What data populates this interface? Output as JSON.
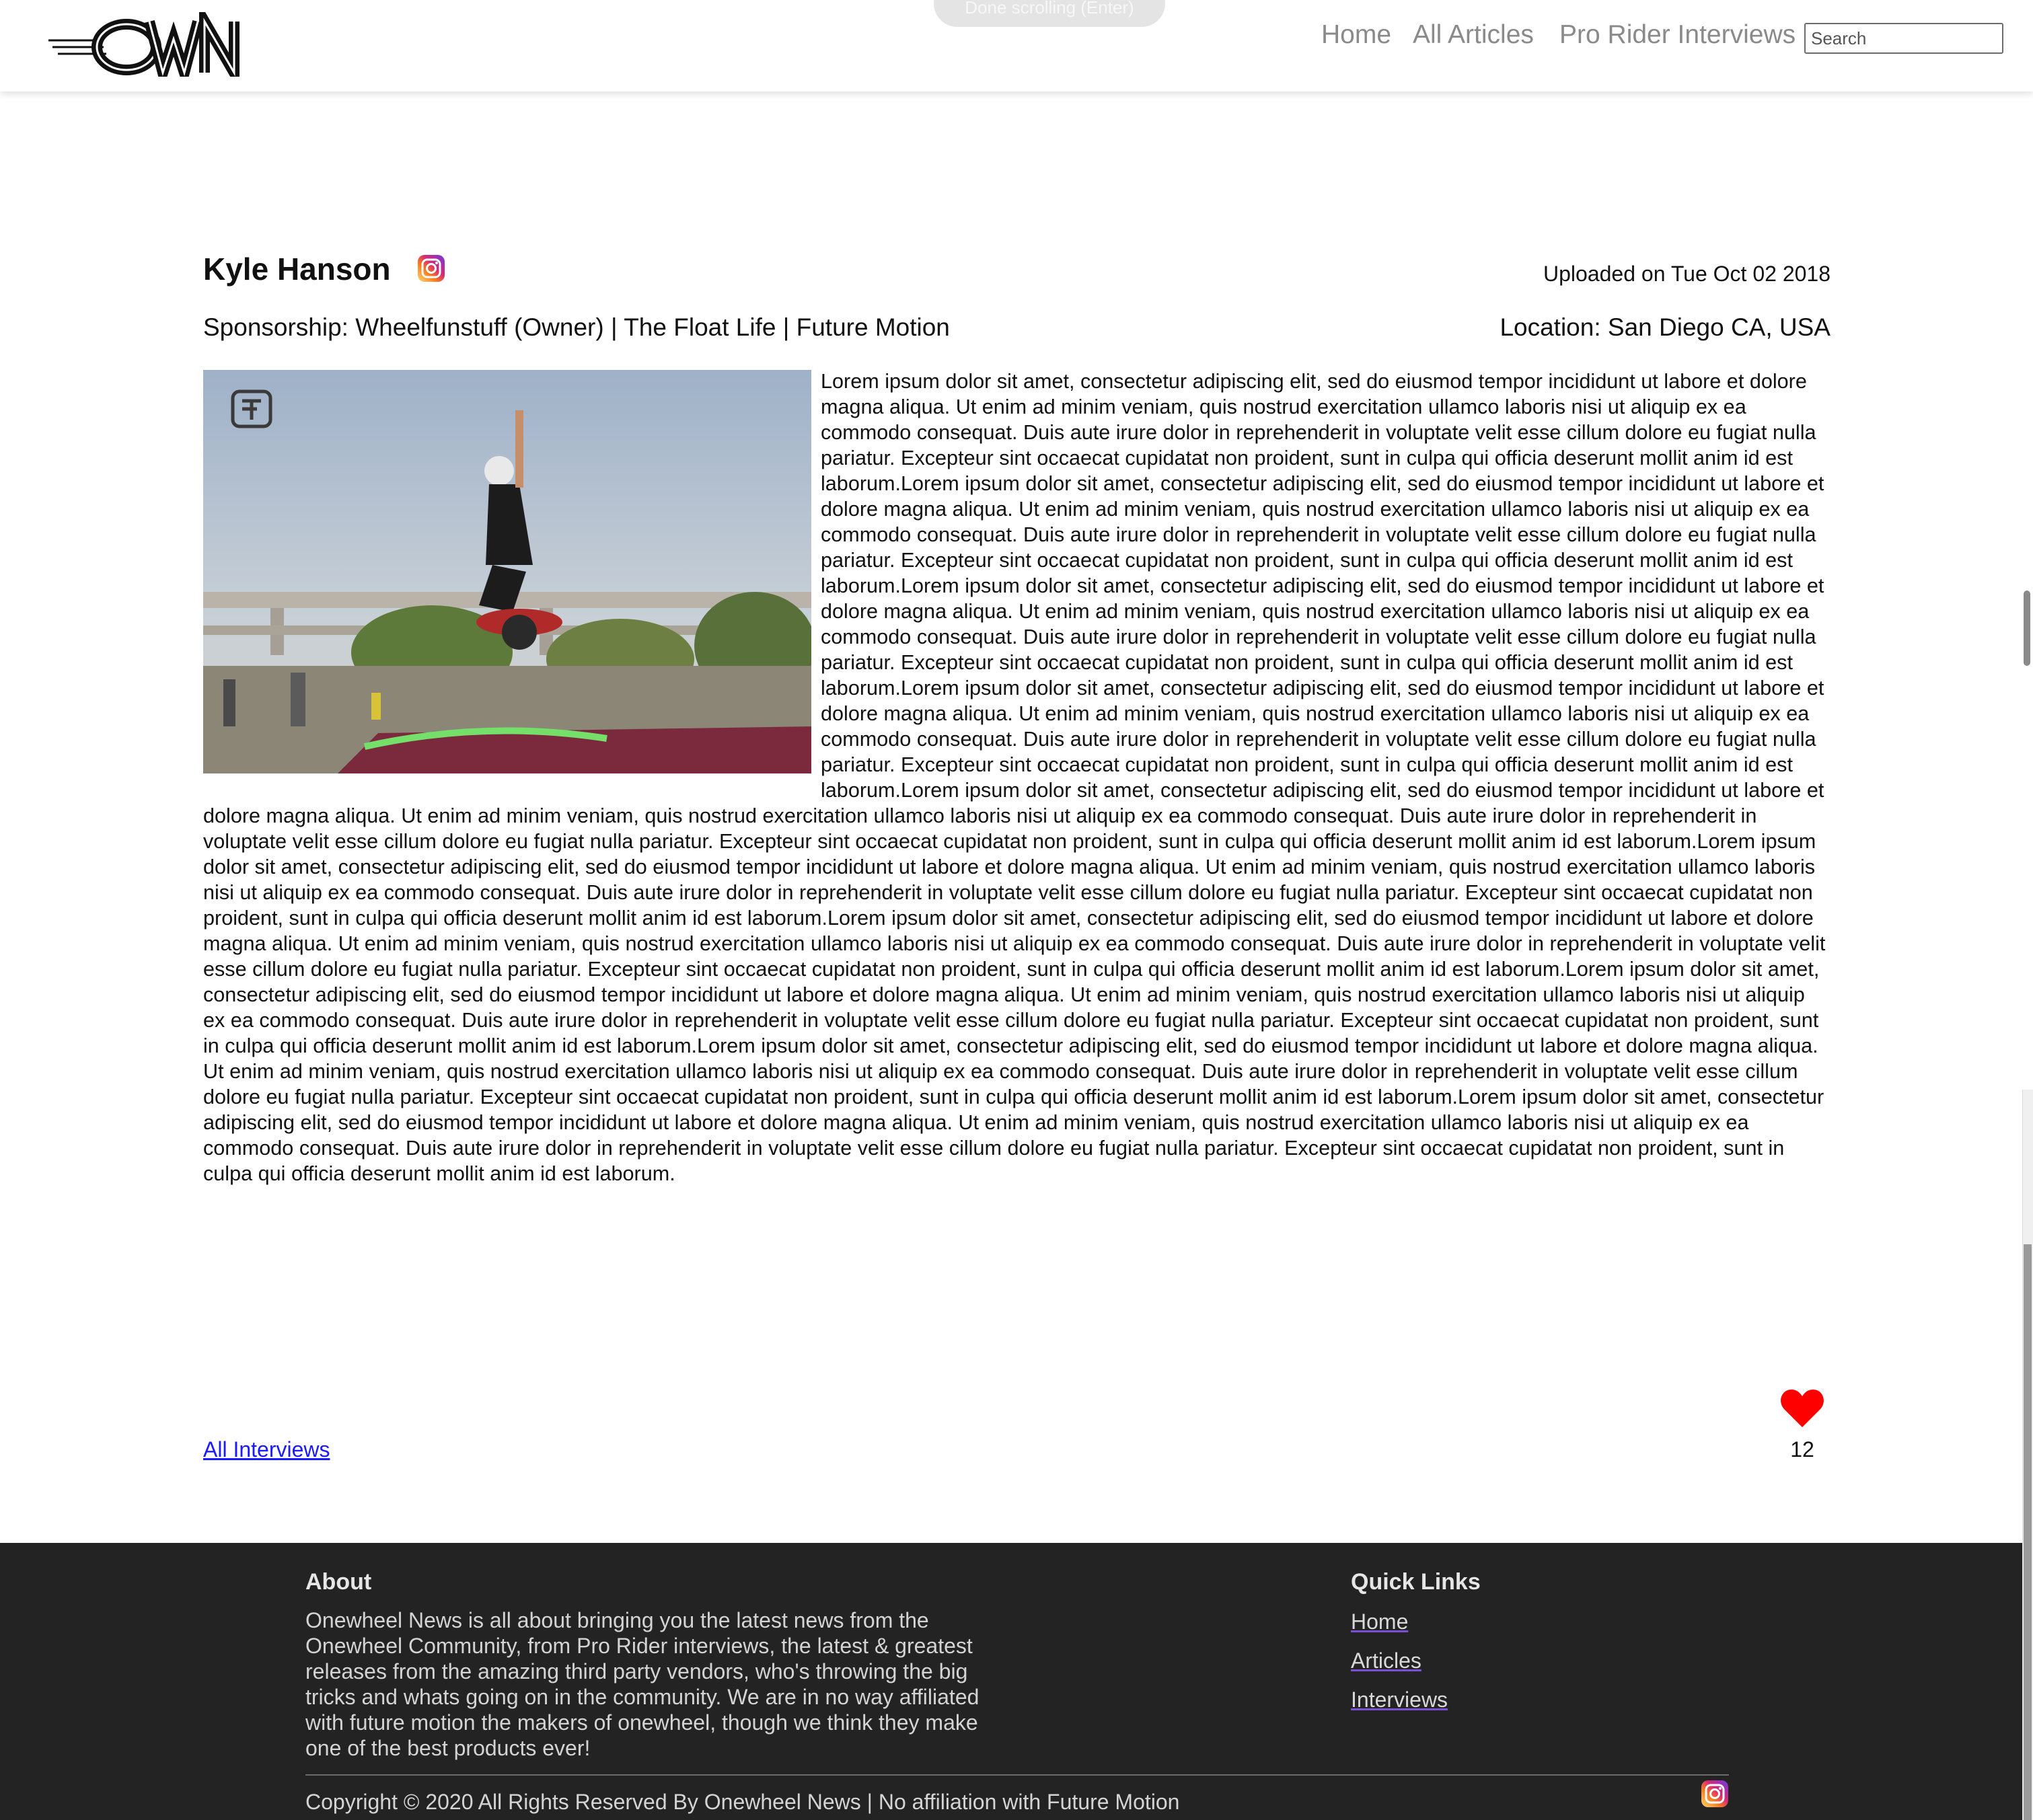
{
  "header": {
    "toast": "Done scrolling (Enter)",
    "nav": {
      "home": "Home",
      "articles": "All Articles",
      "interviews": "Pro Rider Interviews"
    },
    "search_placeholder": "Search"
  },
  "interview": {
    "name": "Kyle Hanson",
    "uploaded": "Uploaded on Tue Oct 02 2018",
    "sponsorship": "Sponsorship: Wheelfunstuff (Owner) | The Float Life | Future Motion",
    "location": "Location: San Diego CA, USA",
    "body": "Lorem ipsum dolor sit amet, consectetur adipiscing elit, sed do eiusmod tempor incididunt ut labore et dolore magna aliqua. Ut enim ad minim veniam, quis nostrud exercitation ullamco laboris nisi ut aliquip ex ea commodo consequat. Duis aute irure dolor in reprehenderit in voluptate velit esse cillum dolore eu fugiat nulla pariatur. Excepteur sint occaecat cupidatat non proident, sunt in culpa qui officia deserunt mollit anim id est laborum.Lorem ipsum dolor sit amet, consectetur adipiscing elit, sed do eiusmod tempor incididunt ut labore et dolore magna aliqua. Ut enim ad minim veniam, quis nostrud exercitation ullamco laboris nisi ut aliquip ex ea commodo consequat. Duis aute irure dolor in reprehenderit in voluptate velit esse cillum dolore eu fugiat nulla pariatur. Excepteur sint occaecat cupidatat non proident, sunt in culpa qui officia deserunt mollit anim id est laborum.Lorem ipsum dolor sit amet, consectetur adipiscing elit, sed do eiusmod tempor incididunt ut labore et dolore magna aliqua. Ut enim ad minim veniam, quis nostrud exercitation ullamco laboris nisi ut aliquip ex ea commodo consequat. Duis aute irure dolor in reprehenderit in voluptate velit esse cillum dolore eu fugiat nulla pariatur. Excepteur sint occaecat cupidatat non proident, sunt in culpa qui officia deserunt mollit anim id est laborum.Lorem ipsum dolor sit amet, consectetur adipiscing elit, sed do eiusmod tempor incididunt ut labore et dolore magna aliqua. Ut enim ad minim veniam, quis nostrud exercitation ullamco laboris nisi ut aliquip ex ea commodo consequat. Duis aute irure dolor in reprehenderit in voluptate velit esse cillum dolore eu fugiat nulla pariatur. Excepteur sint occaecat cupidatat non proident, sunt in culpa qui officia deserunt mollit anim id est laborum.Lorem ipsum dolor sit amet, consectetur adipiscing elit, sed do eiusmod tempor incididunt ut labore et dolore magna aliqua. Ut enim ad minim veniam, quis nostrud exercitation ullamco laboris nisi ut aliquip ex ea commodo consequat. Duis aute irure dolor in reprehenderit in voluptate velit esse cillum dolore eu fugiat nulla pariatur. Excepteur sint occaecat cupidatat non proident, sunt in culpa qui officia deserunt mollit anim id est laborum.Lorem ipsum dolor sit amet, consectetur adipiscing elit, sed do eiusmod tempor incididunt ut labore et dolore magna aliqua. Ut enim ad minim veniam, quis nostrud exercitation ullamco laboris nisi ut aliquip ex ea commodo consequat. Duis aute irure dolor in reprehenderit in voluptate velit esse cillum dolore eu fugiat nulla pariatur. Excepteur sint occaecat cupidatat non proident, sunt in culpa qui officia deserunt mollit anim id est laborum.Lorem ipsum dolor sit amet, consectetur adipiscing elit, sed do eiusmod tempor incididunt ut labore et dolore magna aliqua. Ut enim ad minim veniam, quis nostrud exercitation ullamco laboris nisi ut aliquip ex ea commodo consequat. Duis aute irure dolor in reprehenderit in voluptate velit esse cillum dolore eu fugiat nulla pariatur. Excepteur sint occaecat cupidatat non proident, sunt in culpa qui officia deserunt mollit anim id est laborum.Lorem ipsum dolor sit amet, consectetur adipiscing elit, sed do eiusmod tempor incididunt ut labore et dolore magna aliqua. Ut enim ad minim veniam, quis nostrud exercitation ullamco laboris nisi ut aliquip ex ea commodo consequat. Duis aute irure dolor in reprehenderit in voluptate velit esse cillum dolore eu fugiat nulla pariatur. Excepteur sint occaecat cupidatat non proident, sunt in culpa qui officia deserunt mollit anim id est laborum.Lorem ipsum dolor sit amet, consectetur adipiscing elit, sed do eiusmod tempor incididunt ut labore et dolore magna aliqua. Ut enim ad minim veniam, quis nostrud exercitation ullamco laboris nisi ut aliquip ex ea commodo consequat. Duis aute irure dolor in reprehenderit in voluptate velit esse cillum dolore eu fugiat nulla pariatur. Excepteur sint occaecat cupidatat non proident, sunt in culpa qui officia deserunt mollit anim id est laborum.Lorem ipsum dolor sit amet, consectetur adipiscing elit, sed do eiusmod tempor incididunt ut labore et dolore magna aliqua. Ut enim ad minim veniam, quis nostrud exercitation ullamco laboris nisi ut aliquip ex ea commodo consequat. Duis aute irure dolor in reprehenderit in voluptate velit esse cillum dolore eu fugiat nulla pariatur. Excepteur sint occaecat cupidatat non proident, sunt in culpa qui officia deserunt mollit anim id est laborum.",
    "all_interviews_link": "All Interviews",
    "likes": "12"
  },
  "footer": {
    "about_title": "About",
    "about_text": "Onewheel News is all about bringing you the latest news from the Onewheel Community, from Pro Rider interviews, the latest & greatest releases from the amazing third party vendors, who's throwing the big tricks and whats going on in the community. We are in no way affiliated with future motion the makers of onewheel, though we think they make one of the best products ever!",
    "quick_links_title": "Quick Links",
    "links": {
      "home": "Home",
      "articles": "Articles",
      "interviews": "Interviews"
    },
    "copyright": "Copyright © 2020 All Rights Reserved By Onewheel News | No affiliation with Future Motion"
  },
  "icons": {
    "logo": "own-logo",
    "author_social": "instagram-icon",
    "footer_social": "instagram-icon",
    "like": "heart-icon"
  },
  "colors": {
    "link": "#1a1aff",
    "heart": "#ff0000",
    "footer_bg": "#232323",
    "nav_text": "#8a8a8a"
  }
}
